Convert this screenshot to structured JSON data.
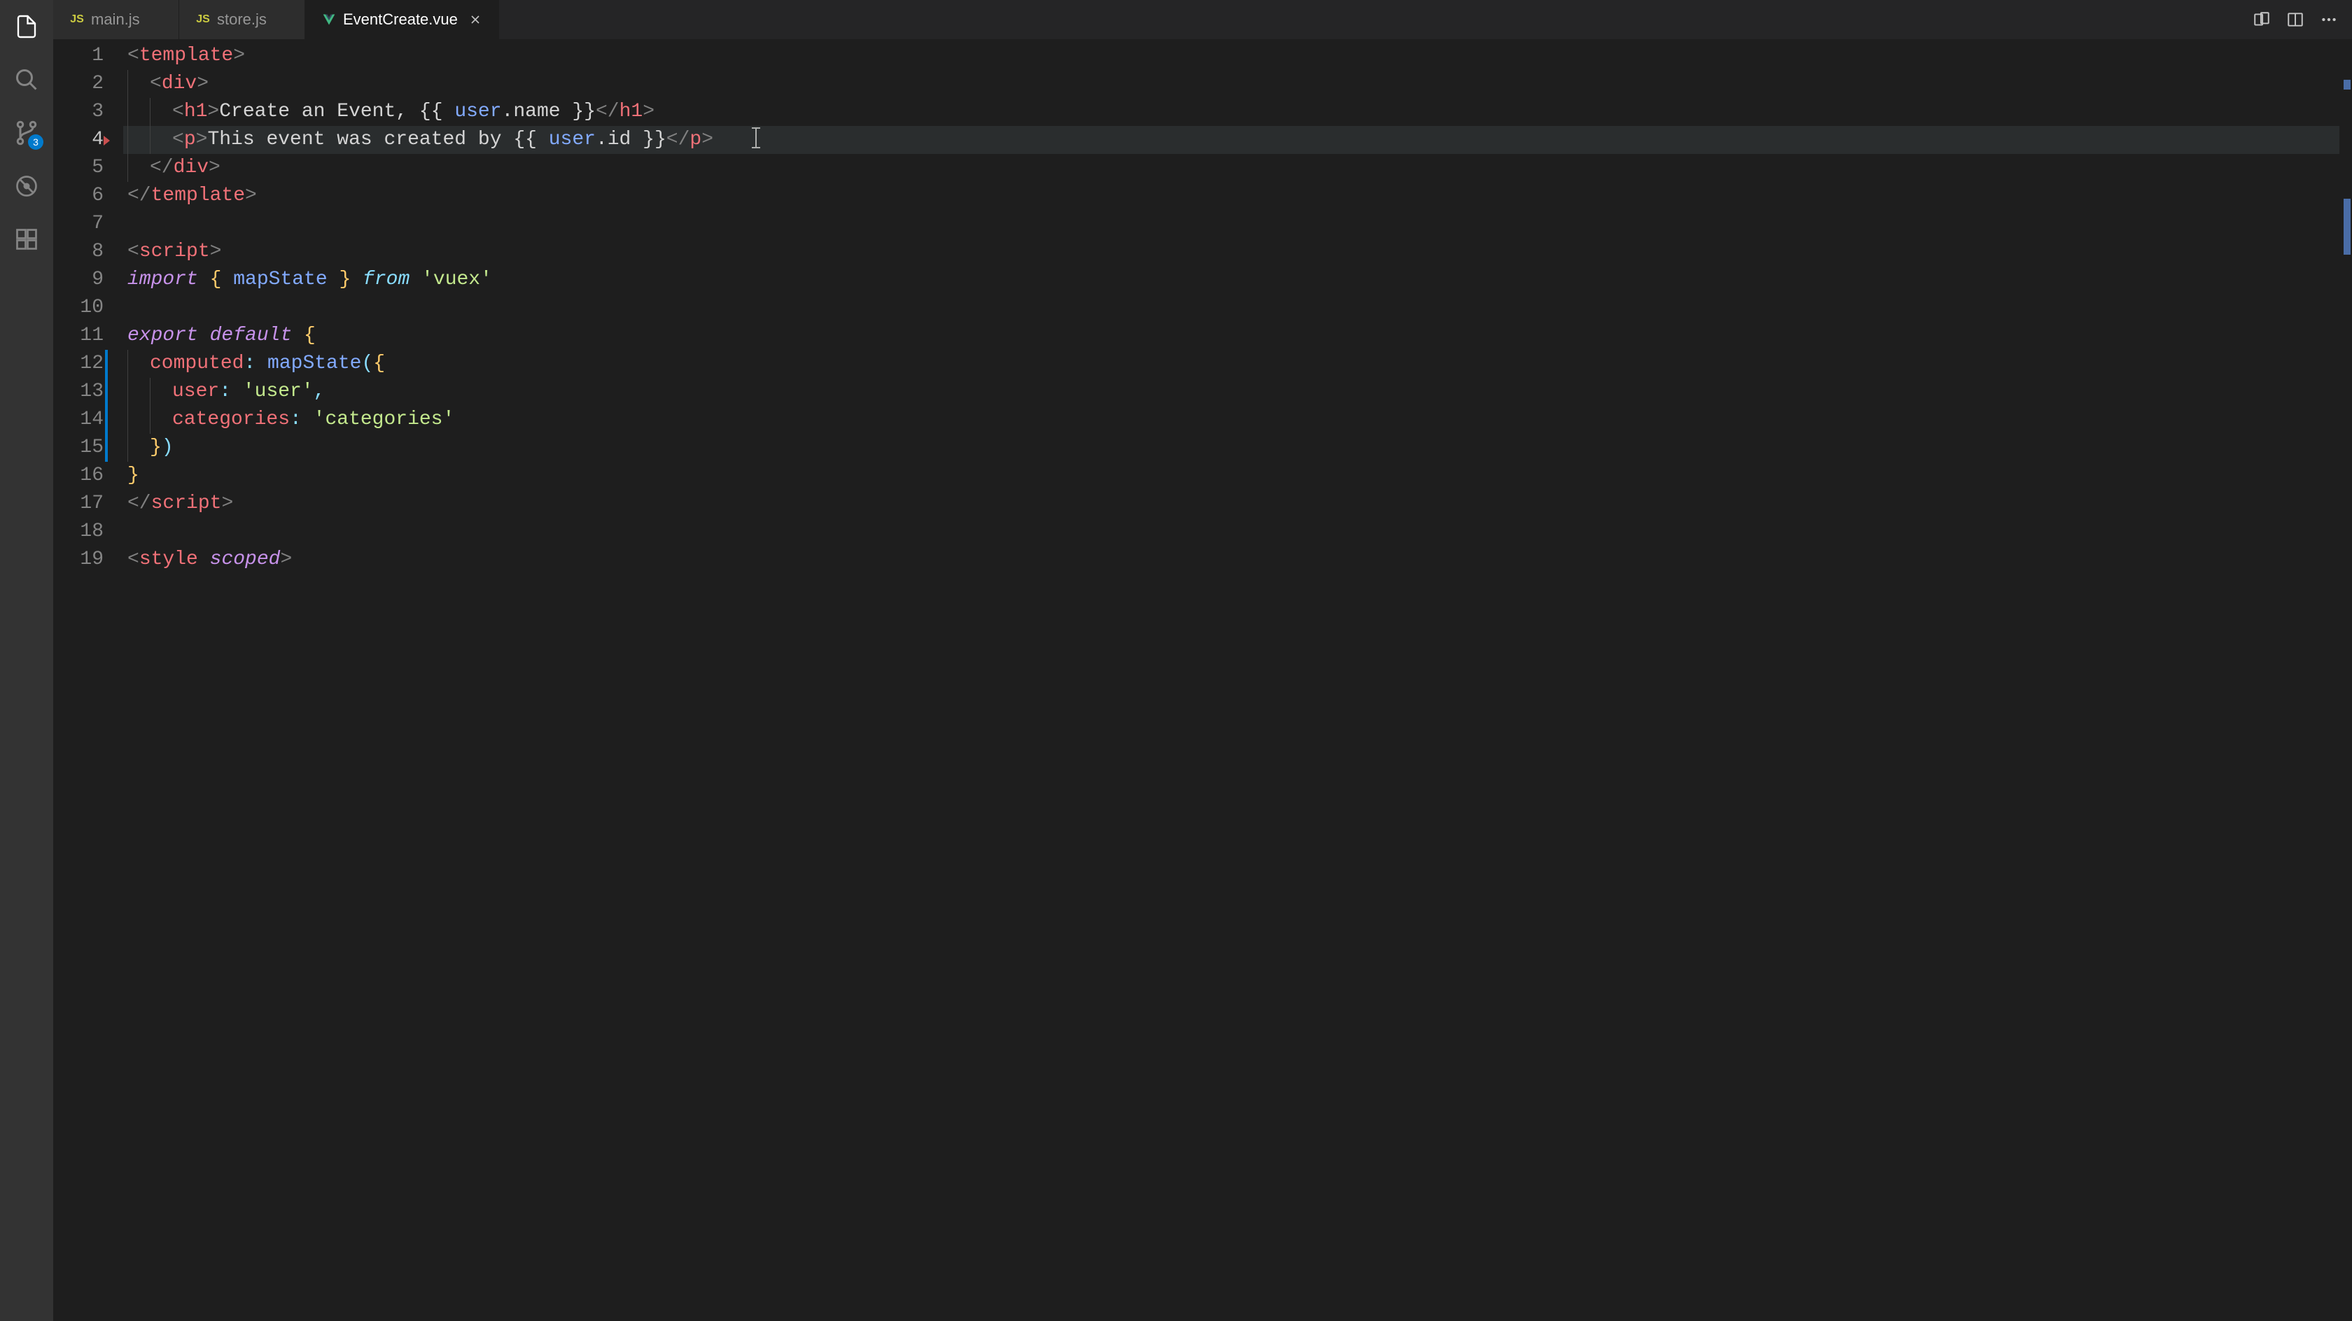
{
  "activityBar": {
    "badge": "3"
  },
  "tabs": [
    {
      "icon": "js",
      "label": "main.js",
      "active": false,
      "dirty": false
    },
    {
      "icon": "js",
      "label": "store.js",
      "active": false,
      "dirty": false
    },
    {
      "icon": "vue",
      "label": "EventCreate.vue",
      "active": true,
      "dirty": false
    }
  ],
  "editor": {
    "currentLine": 4,
    "gitModifiedLines": [
      12,
      13,
      14,
      15
    ],
    "lines": [
      {
        "n": 1,
        "tokens": [
          [
            "<",
            "c-punct"
          ],
          [
            "template",
            "c-tag"
          ],
          [
            ">",
            "c-punct"
          ]
        ]
      },
      {
        "n": 2,
        "indent": 1,
        "tokens": [
          [
            "<",
            "c-punct"
          ],
          [
            "div",
            "c-tag"
          ],
          [
            ">",
            "c-punct"
          ]
        ]
      },
      {
        "n": 3,
        "indent": 2,
        "tokens": [
          [
            "<",
            "c-punct"
          ],
          [
            "h1",
            "c-tag"
          ],
          [
            ">",
            "c-punct"
          ],
          [
            "Create an Event, ",
            "c-text"
          ],
          [
            "{{ ",
            "c-brace"
          ],
          [
            "user",
            "c-var"
          ],
          [
            ".name",
            "c-prop"
          ],
          [
            " }}",
            "c-brace"
          ],
          [
            "</",
            "c-punct"
          ],
          [
            "h1",
            "c-tag"
          ],
          [
            ">",
            "c-punct"
          ]
        ]
      },
      {
        "n": 4,
        "indent": 2,
        "highlighted": true,
        "cursor": true,
        "foldTriangle": true,
        "tokens": [
          [
            "<",
            "c-punct"
          ],
          [
            "p",
            "c-tag"
          ],
          [
            ">",
            "c-punct"
          ],
          [
            "This event was created by ",
            "c-text"
          ],
          [
            "{{ ",
            "c-brace"
          ],
          [
            "user",
            "c-var"
          ],
          [
            ".id",
            "c-prop"
          ],
          [
            " }}",
            "c-brace"
          ],
          [
            "</",
            "c-punct"
          ],
          [
            "p",
            "c-tag"
          ],
          [
            ">",
            "c-punct"
          ]
        ]
      },
      {
        "n": 5,
        "indent": 1,
        "tokens": [
          [
            "</",
            "c-punct"
          ],
          [
            "div",
            "c-tag"
          ],
          [
            ">",
            "c-punct"
          ]
        ]
      },
      {
        "n": 6,
        "tokens": [
          [
            "</",
            "c-punct"
          ],
          [
            "template",
            "c-tag"
          ],
          [
            ">",
            "c-punct"
          ]
        ]
      },
      {
        "n": 7,
        "tokens": []
      },
      {
        "n": 8,
        "tokens": [
          [
            "<",
            "c-punct"
          ],
          [
            "script",
            "c-tag"
          ],
          [
            ">",
            "c-punct"
          ]
        ]
      },
      {
        "n": 9,
        "tokens": [
          [
            "import ",
            "c-keyword"
          ],
          [
            "{ ",
            "c-curly"
          ],
          [
            "mapState",
            "c-func"
          ],
          [
            " }",
            "c-curly"
          ],
          [
            " from ",
            "c-keyword2"
          ],
          [
            "'vuex'",
            "c-string"
          ]
        ]
      },
      {
        "n": 10,
        "tokens": []
      },
      {
        "n": 11,
        "tokens": [
          [
            "export default ",
            "c-keyword"
          ],
          [
            "{",
            "c-curly"
          ]
        ]
      },
      {
        "n": 12,
        "indent": 1,
        "git": true,
        "tokens": [
          [
            "computed",
            "c-propname"
          ],
          [
            ":",
            "c-paren"
          ],
          [
            " ",
            "c-text"
          ],
          [
            "mapState",
            "c-func"
          ],
          [
            "(",
            "c-paren"
          ],
          [
            "{",
            "c-curly"
          ]
        ]
      },
      {
        "n": 13,
        "indent": 2,
        "git": true,
        "tokens": [
          [
            "user",
            "c-propname"
          ],
          [
            ":",
            "c-paren"
          ],
          [
            " ",
            "c-text"
          ],
          [
            "'user'",
            "c-string"
          ],
          [
            ",",
            "c-paren"
          ]
        ]
      },
      {
        "n": 14,
        "indent": 2,
        "git": true,
        "tokens": [
          [
            "categories",
            "c-propname"
          ],
          [
            ":",
            "c-paren"
          ],
          [
            " ",
            "c-text"
          ],
          [
            "'categories'",
            "c-string"
          ]
        ]
      },
      {
        "n": 15,
        "indent": 1,
        "git": true,
        "tokens": [
          [
            "}",
            "c-curly"
          ],
          [
            ")",
            "c-paren"
          ]
        ]
      },
      {
        "n": 16,
        "tokens": [
          [
            "}",
            "c-curly"
          ]
        ]
      },
      {
        "n": 17,
        "tokens": [
          [
            "</",
            "c-punct"
          ],
          [
            "script",
            "c-tag"
          ],
          [
            ">",
            "c-punct"
          ]
        ]
      },
      {
        "n": 18,
        "tokens": []
      },
      {
        "n": 19,
        "tokens": [
          [
            "<",
            "c-punct"
          ],
          [
            "style",
            "c-tag"
          ],
          [
            " ",
            "c-text"
          ],
          [
            "scoped",
            "c-attr"
          ],
          [
            ">",
            "c-punct"
          ]
        ]
      }
    ]
  }
}
